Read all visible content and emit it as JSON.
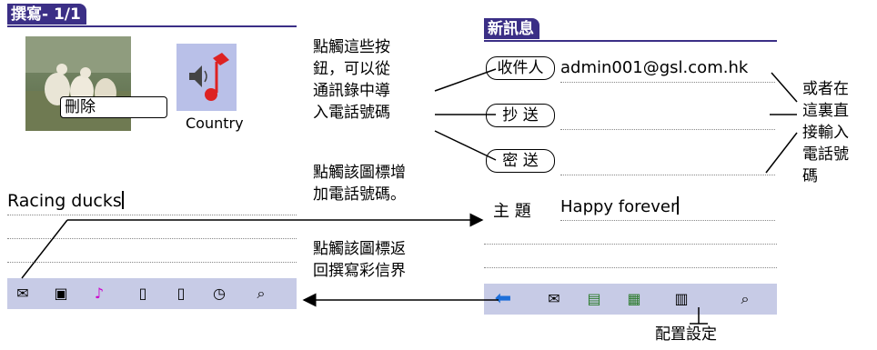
{
  "left_screen": {
    "title": "撰寫- 1/1",
    "delete_label": "刪除",
    "audio_caption": "Country",
    "message_text": "Racing ducks"
  },
  "right_screen": {
    "title": "新訊息",
    "to_label": "收件人",
    "to_value": "admin001@gsl.com.hk",
    "cc_label": "抄 送",
    "bcc_label": "密 送",
    "subject_label": "主 題",
    "subject_value": "Happy forever"
  },
  "notes": {
    "contacts_note": [
      "點觸這些按",
      "鈕，可以從",
      "通訊錄中導",
      "入電話號碼"
    ],
    "add_icon_note": [
      "點觸該圖標增",
      "加電話號碼。"
    ],
    "back_icon_note": [
      "點觸該圖標返",
      "回撰寫彩信界"
    ],
    "direct_input_note": [
      "或者在",
      "這裏直",
      "接輸入",
      "電話號",
      "碼"
    ],
    "config_note": "配置設定"
  },
  "colors": {
    "accent": "#3b2f86",
    "arrow_blue": "#1e6fd9"
  }
}
